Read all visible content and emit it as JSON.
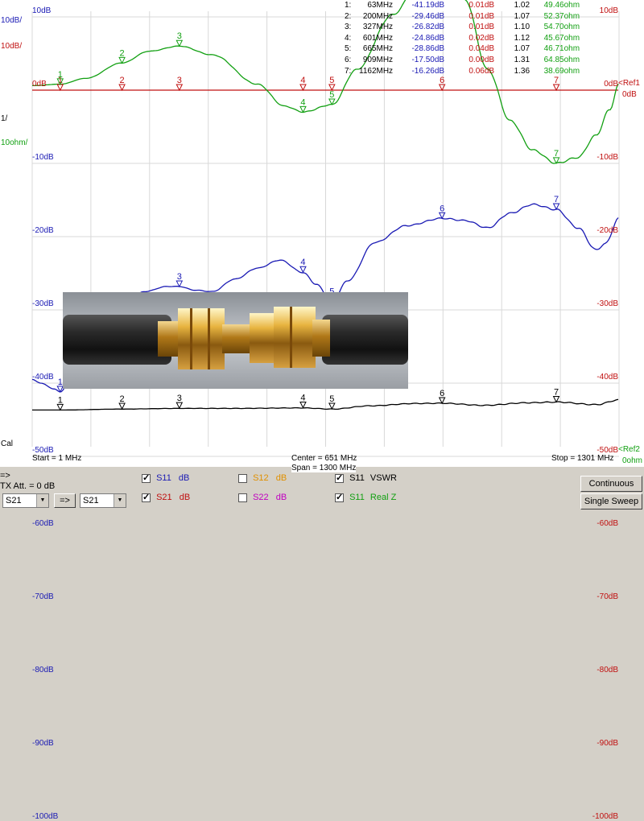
{
  "chart_data": {
    "type": "line",
    "x_range_mhz": [
      1,
      1301
    ],
    "left_scale_blue_label": "10dB/",
    "left_scale_red_label": "10dB/",
    "scale_1_label": "1/",
    "scale_ohm_label": "10ohm/",
    "ref_label": "<Ref",
    "ref_label_2": "<Ref",
    "ref_suffix_0db": "0dB",
    "ref_suffix_0ohm": "0ohm",
    "ref_digit_1": "1",
    "ref_digit_2": "2",
    "y_ticks_left": [
      "10dB",
      "0dB",
      "-10dB",
      "-20dB",
      "-30dB",
      "-40dB",
      "-50dB",
      "-60dB",
      "-70dB",
      "-80dB",
      "-90dB",
      "-100dB"
    ],
    "y_ticks_right": [
      "10dB",
      "0dB",
      "-10dB",
      "-20dB",
      "-30dB",
      "-40dB",
      "-50dB",
      "-60dB",
      "-70dB",
      "-80dB",
      "-90dB",
      "-100dB"
    ],
    "cal_label": "Cal",
    "start_label": "Start = 1 MHz",
    "center_label": "Center = 651 MHz",
    "span_label": "Span = 1300 MHz",
    "stop_label": "Stop = 1301 MHz",
    "markers": [
      {
        "n": "1:",
        "f": "63MHz",
        "s11": "-41.19dB",
        "s21": "0.01dB",
        "vswr": "1.02",
        "z": "49.46ohm"
      },
      {
        "n": "2:",
        "f": "200MHz",
        "s11": "-29.46dB",
        "s21": "0.01dB",
        "vswr": "1.07",
        "z": "52.37ohm"
      },
      {
        "n": "3:",
        "f": "327MHz",
        "s11": "-26.82dB",
        "s21": "0.01dB",
        "vswr": "1.10",
        "z": "54.70ohm"
      },
      {
        "n": "4:",
        "f": "601MHz",
        "s11": "-24.86dB",
        "s21": "0.02dB",
        "vswr": "1.12",
        "z": "45.67ohm"
      },
      {
        "n": "5:",
        "f": "665MHz",
        "s11": "-28.86dB",
        "s21": "0.04dB",
        "vswr": "1.07",
        "z": "46.71ohm"
      },
      {
        "n": "6:",
        "f": "909MHz",
        "s11": "-17.50dB",
        "s21": "0.00dB",
        "vswr": "1.31",
        "z": "64.85ohm"
      },
      {
        "n": "7:",
        "f": "1162MHz",
        "s11": "-16.26dB",
        "s21": "0.06dB",
        "vswr": "1.36",
        "z": "38.69ohm"
      }
    ],
    "marker_labels": [
      "1",
      "2",
      "3",
      "4",
      "5",
      "6",
      "7"
    ],
    "series": [
      {
        "name": "S11 dB",
        "color": "#1a1ab4",
        "x": [
          1,
          20,
          50,
          63,
          100,
          150,
          200,
          250,
          300,
          327,
          360,
          400,
          450,
          500,
          550,
          601,
          630,
          665,
          700,
          760,
          830,
          909,
          960,
          1010,
          1060,
          1110,
          1162,
          1210,
          1250,
          1270,
          1301
        ],
        "y": [
          -39.5,
          -40.0,
          -40.8,
          -41.2,
          -37.5,
          -32.0,
          -29.5,
          -27.5,
          -26.8,
          -26.8,
          -27.3,
          -27.5,
          -25.8,
          -24.3,
          -23.2,
          -24.9,
          -26.5,
          -28.9,
          -26.0,
          -20.8,
          -18.5,
          -17.5,
          -17.8,
          -18.8,
          -16.8,
          -15.6,
          -16.3,
          -18.8,
          -21.8,
          -21.0,
          -17.5
        ]
      },
      {
        "name": "S21 dB",
        "color": "#c01010",
        "x": [
          1,
          1301
        ],
        "y": [
          0,
          0
        ]
      },
      {
        "name": "S11 VSWR",
        "color": "#000000",
        "x": [
          1,
          63,
          200,
          327,
          450,
          601,
          665,
          750,
          850,
          909,
          1000,
          1100,
          1162,
          1250,
          1301
        ],
        "y": [
          1.02,
          1.02,
          1.06,
          1.09,
          1.09,
          1.11,
          1.06,
          1.2,
          1.3,
          1.31,
          1.22,
          1.33,
          1.36,
          1.25,
          1.45
        ]
      },
      {
        "name": "S11 RealZ",
        "color": "#12a012",
        "x": [
          1,
          63,
          120,
          200,
          260,
          327,
          400,
          500,
          560,
          601,
          665,
          720,
          800,
          860,
          909,
          960,
          1010,
          1060,
          1110,
          1162,
          1210,
          1250,
          1280,
          1301
        ],
        "y": [
          49.3,
          49.5,
          50.3,
          52.4,
          54.0,
          54.7,
          53.5,
          49.5,
          46.5,
          45.7,
          46.7,
          51.5,
          59.0,
          63.5,
          64.9,
          61.0,
          51.5,
          44.5,
          40.5,
          38.7,
          39.5,
          42.5,
          46.0,
          49.5
        ]
      }
    ]
  },
  "controls": {
    "arrow": "=>",
    "tx_att": "TX Att. = 0 dB",
    "select1": "S21",
    "select2": "S21",
    "swap_btn": "=>",
    "cb_s11": {
      "name": "S11",
      "unit": "dB",
      "checked": true
    },
    "cb_s21": {
      "name": "S21",
      "unit": "dB",
      "checked": true
    },
    "cb_s12": {
      "name": "S12",
      "unit": "dB",
      "checked": false
    },
    "cb_s22": {
      "name": "S22",
      "unit": "dB",
      "checked": false
    },
    "cb_vswr": {
      "name": "S11",
      "unit": "VSWR",
      "checked": true
    },
    "cb_realz": {
      "name": "S11",
      "unit": "Real Z",
      "checked": true
    },
    "continuous": "Continuous",
    "single_sweep": "Single Sweep"
  },
  "colors": {
    "s11": "#1a1ab4",
    "s21": "#c01010",
    "s12": "#e09000",
    "s22": "#c000c0",
    "vswr": "#000000",
    "realz": "#12a012",
    "grid": "#d8d8d8"
  }
}
